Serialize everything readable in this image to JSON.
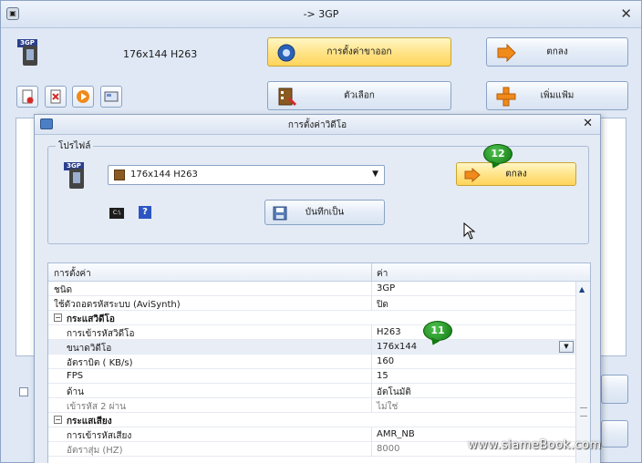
{
  "window": {
    "title": "-> 3GP"
  },
  "top": {
    "profile_label": "176x144 H263",
    "output_settings_label": "การตั้งค่าขาออก",
    "ok_label": "ตกลง",
    "options_label": "ตัวเลือก",
    "add_label": "เพิ่มแฟ้ม"
  },
  "dialog": {
    "title": "การตั้งค่าวิดีโอ",
    "profile_group": "โปรไฟล์",
    "profile_value": "176x144 H263",
    "ok_label": "ตกลง",
    "save_as_label": "บันทึกเป็น",
    "help_glyph": "?"
  },
  "callouts": {
    "ok": "12",
    "size": "11"
  },
  "grid": {
    "header_setting": "การตั้งค่า",
    "header_value": "ค่า",
    "rows": [
      {
        "key": "ชนิด",
        "value": "3GP"
      },
      {
        "key": "ใช้ตัวถอดรหัสระบบ (AviSynth)",
        "value": "ปิด"
      },
      {
        "key": "กระแสวิดีโอ",
        "value": ""
      },
      {
        "key": "การเข้ารหัสวิดีโอ",
        "value": "H263"
      },
      {
        "key": "ขนาดวิดีโอ",
        "value": "176x144"
      },
      {
        "key": "อัตราบิต ( KB/s)",
        "value": "160"
      },
      {
        "key": "FPS",
        "value": "15"
      },
      {
        "key": "ด้าน",
        "value": "อัตโนมัติ"
      },
      {
        "key": "เข้ารหัส 2 ผ่าน",
        "value": "ไม่ใช่"
      },
      {
        "key": "กระแสเสียง",
        "value": ""
      },
      {
        "key": "การเข้ารหัสเสียง",
        "value": "AMR_NB"
      },
      {
        "key": "อัตราสุ่ม (HZ)",
        "value": "8000"
      }
    ]
  },
  "watermark": "www.siameBook.com"
}
